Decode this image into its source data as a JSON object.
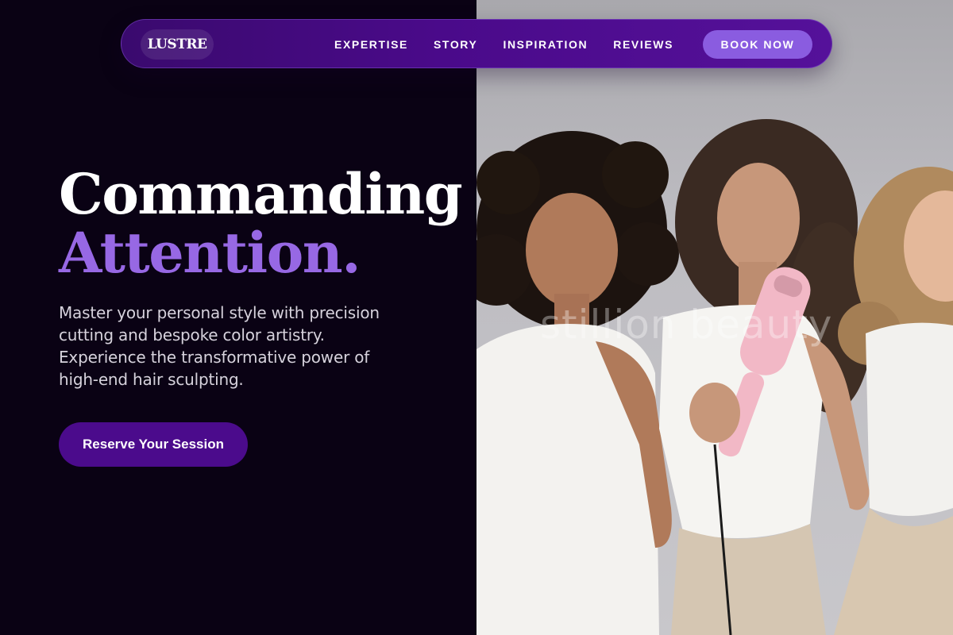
{
  "brand": {
    "logo": "LUSTRE"
  },
  "nav": {
    "items": [
      {
        "label": "EXPERTISE"
      },
      {
        "label": "STORY"
      },
      {
        "label": "INSPIRATION"
      },
      {
        "label": "REVIEWS"
      }
    ],
    "cta_label": "BOOK NOW"
  },
  "hero": {
    "title_line1": "Commanding",
    "title_line2": "Attention.",
    "description": "Master your personal style with precision cutting and bespoke color artistry. Experience the transformative power of high-end hair sculpting.",
    "cta_label": "Reserve Your Session"
  },
  "photo": {
    "watermark": "stillion beauty",
    "description_icon": "three-models-photo"
  },
  "colors": {
    "background": "#0a0214",
    "nav": "#4a0a8a",
    "accent": "#9768e4",
    "book_button": "#8a5ce0",
    "reserve_button": "#4b0b8c"
  }
}
